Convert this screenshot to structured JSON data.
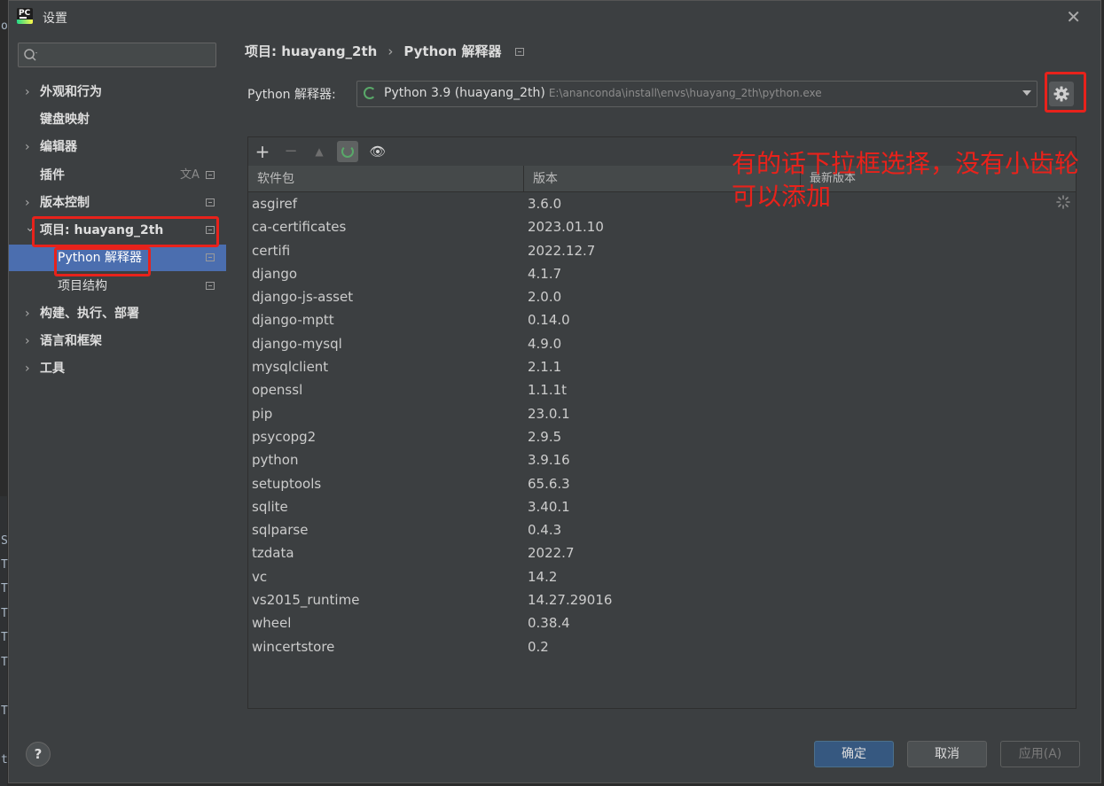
{
  "window": {
    "title": "设置",
    "close_glyph": "✕"
  },
  "background_margin": [
    "or",
    "S",
    "T",
    "T",
    "T",
    "T",
    "T",
    "T",
    "t"
  ],
  "sidebar": {
    "search": {
      "placeholder": "",
      "value": ""
    },
    "items": [
      {
        "label": "外观和行为",
        "expandable": true,
        "expanded": false
      },
      {
        "label": "键盘映射",
        "expandable": false
      },
      {
        "label": "编辑器",
        "expandable": true,
        "expanded": false
      },
      {
        "label": "插件",
        "expandable": false,
        "icon": "translate-icon"
      },
      {
        "label": "版本控制",
        "expandable": true,
        "expanded": false
      },
      {
        "label": "项目: huayang_2th",
        "expandable": true,
        "expanded": true
      },
      {
        "label": "Python 解释器",
        "child": true,
        "selected": true
      },
      {
        "label": "项目结构",
        "child": true
      },
      {
        "label": "构建、执行、部署",
        "expandable": true,
        "expanded": false
      },
      {
        "label": "语言和框架",
        "expandable": true,
        "expanded": false
      },
      {
        "label": "工具",
        "expandable": true,
        "expanded": false
      }
    ],
    "arrow_collapsed": "›",
    "arrow_expanded": "⌄",
    "translate_glyph": "文A"
  },
  "breadcrumb": {
    "project": "项目: huayang_2th",
    "separator": "›",
    "page": "Python 解释器"
  },
  "interpreter": {
    "label": "Python 解释器:",
    "name": "Python 3.9 (huayang_2th)",
    "path": "E:\\ananconda\\install\\envs\\huayang_2th\\python.exe"
  },
  "toolbar": {
    "add": "+",
    "remove": "−",
    "up": "▲",
    "eye": "👁"
  },
  "table": {
    "headers": [
      "软件包",
      "版本",
      "最新版本"
    ],
    "rows": [
      {
        "name": "asgiref",
        "version": "3.6.0"
      },
      {
        "name": "ca-certificates",
        "version": "2023.01.10"
      },
      {
        "name": "certifi",
        "version": "2022.12.7"
      },
      {
        "name": "django",
        "version": "4.1.7"
      },
      {
        "name": "django-js-asset",
        "version": "2.0.0"
      },
      {
        "name": "django-mptt",
        "version": "0.14.0"
      },
      {
        "name": "django-mysql",
        "version": "4.9.0"
      },
      {
        "name": "mysqlclient",
        "version": "2.1.1"
      },
      {
        "name": "openssl",
        "version": "1.1.1t"
      },
      {
        "name": "pip",
        "version": "23.0.1"
      },
      {
        "name": "psycopg2",
        "version": "2.9.5"
      },
      {
        "name": "python",
        "version": "3.9.16"
      },
      {
        "name": "setuptools",
        "version": "65.6.3"
      },
      {
        "name": "sqlite",
        "version": "3.40.1"
      },
      {
        "name": "sqlparse",
        "version": "0.4.3"
      },
      {
        "name": "tzdata",
        "version": "2022.7"
      },
      {
        "name": "vc",
        "version": "14.2"
      },
      {
        "name": "vs2015_runtime",
        "version": "14.27.29016"
      },
      {
        "name": "wheel",
        "version": "0.38.4"
      },
      {
        "name": "wincertstore",
        "version": "0.2"
      }
    ]
  },
  "annotation": {
    "text": "有的话下拉框选择，没有小齿轮可以添加",
    "color": "#e8221b"
  },
  "footer": {
    "help": "?",
    "ok": "确定",
    "cancel": "取消",
    "apply": "应用(A)"
  },
  "colors": {
    "selection": "#4b6eaf",
    "highlight_box": "#e8221b",
    "primary_button": "#365880"
  }
}
